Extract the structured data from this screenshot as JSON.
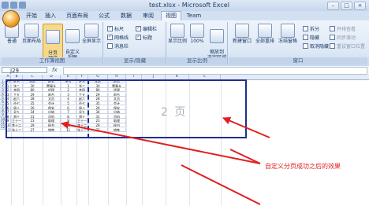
{
  "window": {
    "title": "test.xlsx - Microsoft Excel"
  },
  "tabs": [
    "开始",
    "插入",
    "页面布局",
    "公式",
    "数据",
    "审阅",
    "视图",
    "Team"
  ],
  "active_tab": "视图",
  "ribbon": {
    "views": {
      "buttons": [
        "普通",
        "页面布局",
        "分页\n预览",
        "自定义\n视图",
        "全屏显示"
      ],
      "group_label": "工作簿视图"
    },
    "show_hide": {
      "checks": [
        {
          "label": "标尺",
          "checked": true
        },
        {
          "label": "编辑栏",
          "checked": true
        },
        {
          "label": "网格线",
          "checked": true
        },
        {
          "label": "标题",
          "checked": true
        },
        {
          "label": "消息栏",
          "checked": false
        }
      ],
      "group_label": "显示/隐藏"
    },
    "zoom": {
      "buttons": [
        "显示比例",
        "100%",
        "缩放到\n选定区域"
      ],
      "group_label": "显示比例"
    },
    "window_group": {
      "buttons": [
        "新建窗口",
        "全部重排",
        "冻结窗格"
      ],
      "small": [
        "拆分",
        "隐藏",
        "取消隐藏"
      ],
      "small2": [
        "并排查看",
        "同步滚动",
        "重设窗口位置"
      ],
      "group_label": "窗口"
    }
  },
  "formula_bar": {
    "name_box": "J29",
    "fx": "fx",
    "value": ""
  },
  "columns": [
    "A",
    "B",
    "C",
    "D",
    "E",
    "F",
    "G",
    "H",
    "I",
    "J",
    "K",
    "L"
  ],
  "rows": [
    "1",
    "2",
    "3",
    "4",
    "5",
    "6",
    "7",
    "8",
    "9",
    "10",
    "11",
    "12"
  ],
  "table_left": {
    "header": [
      "序号",
      "姓名",
      "年龄",
      "职务"
    ],
    "rows": [
      [
        "1",
        "张三",
        "30",
        "董事长"
      ],
      [
        "2",
        "李四",
        "80",
        "经理"
      ],
      [
        "3",
        "王五",
        "29",
        "前台"
      ],
      [
        "4",
        "赵六",
        "28",
        "文员"
      ],
      [
        "5",
        "孙七",
        "35",
        "会计"
      ],
      [
        "6",
        "周八",
        "26",
        "保安"
      ],
      [
        "7",
        "吴九",
        "34",
        "出纳"
      ],
      [
        "8",
        "郑十",
        "31",
        "司机"
      ],
      [
        "9",
        "王十一",
        "23",
        "助理"
      ],
      [
        "10",
        "李十二",
        "29",
        "秘书"
      ],
      [
        "11",
        "张十三",
        "27",
        "销售"
      ]
    ]
  },
  "table_right": {
    "header": [
      "序号",
      "姓名",
      "年龄",
      "职务"
    ],
    "rows": [
      [
        "1",
        "张三",
        "30",
        "董事长"
      ],
      [
        "2",
        "李四",
        "80",
        "经理"
      ],
      [
        "3",
        "王五",
        "29",
        "前台"
      ],
      [
        "4",
        "赵六",
        "28",
        "文员"
      ],
      [
        "5",
        "孙七",
        "35",
        "会计"
      ],
      [
        "6",
        "周八",
        "26",
        "保安"
      ],
      [
        "7",
        "吴九",
        "34",
        "出纳"
      ],
      [
        "8",
        "郑十",
        "31",
        "司机"
      ],
      [
        "9",
        "王十一",
        "23",
        "助理"
      ],
      [
        "10",
        "李十二",
        "29",
        "秘书"
      ],
      [
        "11",
        "张十三",
        "27",
        "销售"
      ]
    ]
  },
  "page_label": "2 页",
  "annotation": "自定义分页成功之后的效果",
  "colors": {
    "accent": "#1f2e8f",
    "annotation": "#e02020",
    "page_watermark": "#a9b0b9"
  }
}
